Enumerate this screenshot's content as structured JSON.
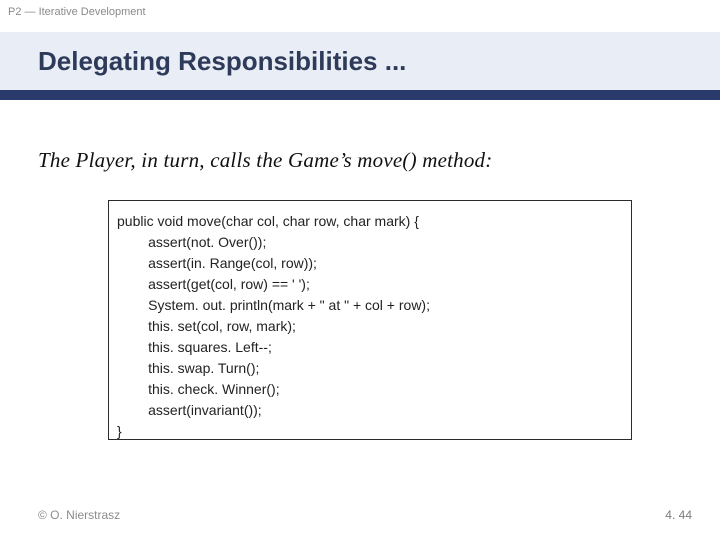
{
  "header": {
    "label": "P2 — Iterative Development"
  },
  "title": "Delegating Responsibilities ...",
  "body_text": "The Player, in turn, calls the Game’s move() method:",
  "code": "public void move(char col, char row, char mark) {\n        assert(not. Over());\n        assert(in. Range(col, row));\n        assert(get(col, row) == ' ');\n        System. out. println(mark + \" at \" + col + row);\n        this. set(col, row, mark);\n        this. squares. Left--;\n        this. swap. Turn();\n        this. check. Winner();\n        assert(invariant());\n}",
  "footer": {
    "copyright": "© O. Nierstrasz",
    "page": "4. 44"
  }
}
